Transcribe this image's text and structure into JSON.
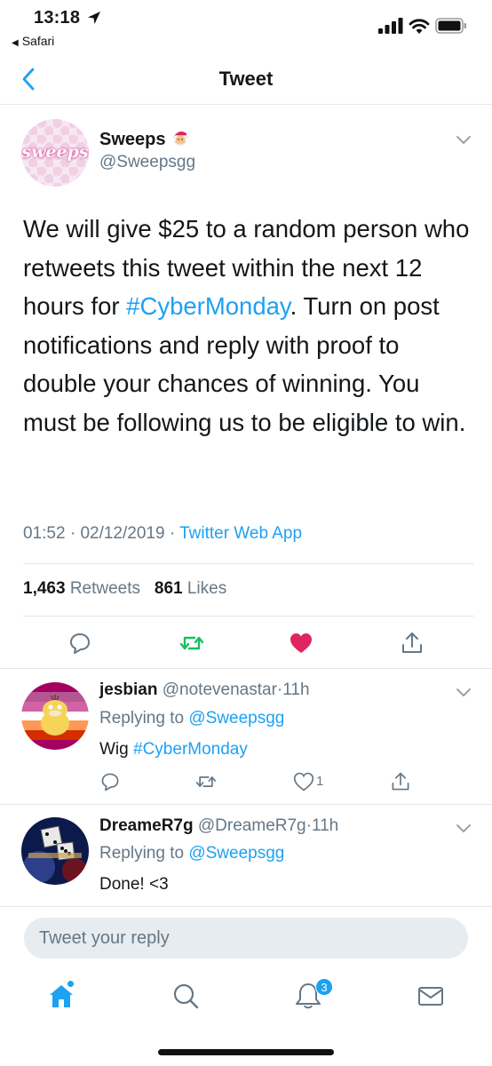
{
  "status_bar": {
    "time": "13:18",
    "back_app": "Safari"
  },
  "nav": {
    "title": "Tweet"
  },
  "tweet": {
    "author_name": "Sweeps",
    "author_handle": "@Sweepsgg",
    "avatar_text": "sweeps",
    "text_before_hashtag": "We will give $25 to a random person who retweets this tweet within the next 12 hours for ",
    "hashtag": "#CyberMonday",
    "text_after_hashtag": ". Turn on post notifications and reply with proof to double your chances of winning. You must be following us to be eligible to win.",
    "time": "01:52",
    "date": "02/12/2019",
    "separator": "·",
    "source_app": "Twitter Web App",
    "retweets_count": "1,463",
    "retweets_label": "Retweets",
    "likes_count": "861",
    "likes_label": "Likes"
  },
  "replies": [
    {
      "name": "jesbian",
      "handle": "@notevenastar",
      "dot": "·",
      "time": "11h",
      "replying_label": "Replying to",
      "replying_to": "@Sweepsgg",
      "text": "Wig",
      "hashtag": "#CyberMonday",
      "like_count": "1"
    },
    {
      "name": "DreameR7g",
      "handle": "@DreameR7g",
      "dot": "·",
      "time": "11h",
      "replying_label": "Replying to",
      "replying_to": "@Sweepsgg",
      "text": "Done! <3"
    }
  ],
  "composer": {
    "placeholder": "Tweet your reply"
  },
  "tab_bar": {
    "notifications_badge": "3"
  },
  "colors": {
    "accent": "#1da1f2",
    "retweet_green": "#17bf63",
    "like_red": "#e0245e",
    "secondary_text": "#657786"
  }
}
